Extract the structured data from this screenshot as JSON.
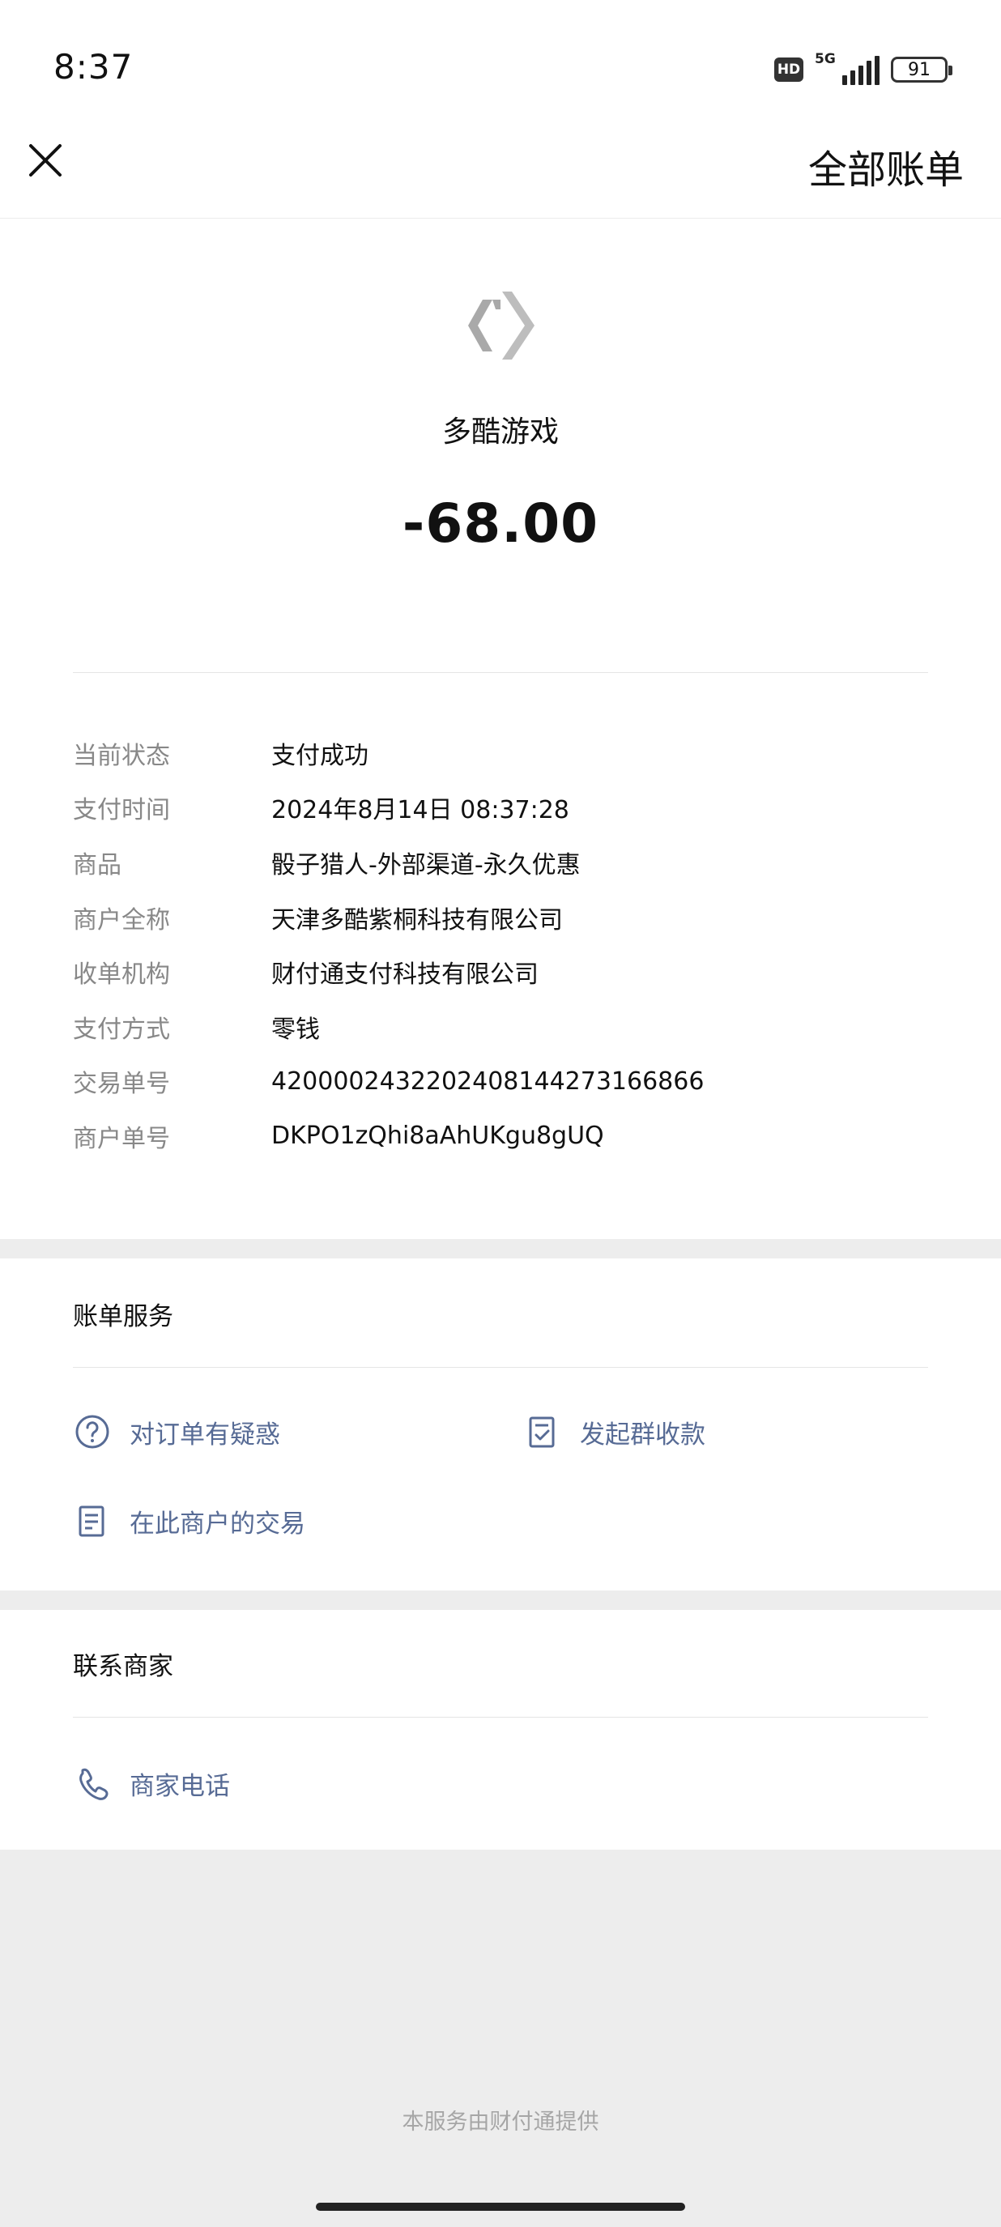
{
  "status_bar": {
    "time": "8:37",
    "hd": "HD",
    "network": "5G",
    "battery": "91"
  },
  "nav": {
    "close_icon": "close-icon",
    "all_bills": "全部账单"
  },
  "transaction": {
    "merchant_name": "多酷游戏",
    "amount": "-68.00",
    "details": [
      {
        "key": "当前状态",
        "value": "支付成功"
      },
      {
        "key": "支付时间",
        "value": "2024年8月14日 08:37:28"
      },
      {
        "key": "商品",
        "value": "骰子猎人-外部渠道-永久优惠"
      },
      {
        "key": "商户全称",
        "value": "天津多酷紫桐科技有限公司"
      },
      {
        "key": "收单机构",
        "value": "财付通支付科技有限公司"
      },
      {
        "key": "支付方式",
        "value": "零钱"
      },
      {
        "key": "交易单号",
        "value": "4200002432202408144273166866"
      },
      {
        "key": "商户单号",
        "value": "DKPO1zQhi8aAhUKgu8gUQ"
      }
    ]
  },
  "bill_service": {
    "title": "账单服务",
    "items": [
      {
        "label": "对订单有疑惑",
        "icon": "question-icon"
      },
      {
        "label": "发起群收款",
        "icon": "checklist-icon"
      },
      {
        "label": "在此商户的交易",
        "icon": "document-icon"
      }
    ]
  },
  "contact_merchant": {
    "title": "联系商家",
    "items": [
      {
        "label": "商家电话",
        "icon": "phone-icon"
      }
    ]
  },
  "footer": {
    "text": "本服务由财付通提供"
  },
  "colors": {
    "link": "#576b95",
    "label_gray": "#888888",
    "band_gray": "#ededed"
  }
}
